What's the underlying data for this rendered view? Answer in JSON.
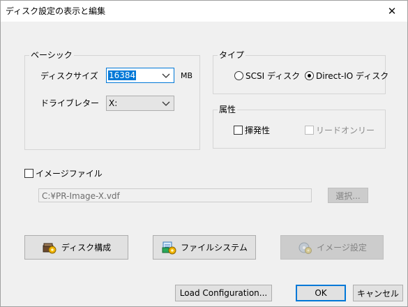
{
  "window": {
    "title": "ディスク設定の表示と編集",
    "close_glyph": "✕"
  },
  "basic": {
    "legend": "ベーシック",
    "disk_size_label": "ディスクサイズ",
    "disk_size_value": "16384",
    "disk_size_unit": "MB",
    "drive_letter_label": "ドライブレター",
    "drive_letter_value": "X:"
  },
  "type": {
    "legend": "タイプ",
    "options": [
      {
        "label": "SCSI ディスク",
        "selected": false
      },
      {
        "label": "Direct-IO ディスク",
        "selected": true
      }
    ]
  },
  "attributes": {
    "legend": "属性",
    "volatile_label": "揮発性",
    "readonly_label": "リードオンリー"
  },
  "image": {
    "checkbox_label": "イメージファイル",
    "path_value": "C:¥PR-Image-X.vdf",
    "browse_label": "選択..."
  },
  "actions": {
    "disk_config_label": "ディスク構成",
    "file_system_label": "ファイルシステム",
    "image_settings_label": "イメージ設定",
    "load_config_label": "Load Configuration...",
    "ok_label": "OK",
    "cancel_label": "キャンセル"
  },
  "icons": {
    "disk_config": "disk-config-icon",
    "file_system": "file-system-icon",
    "image_settings": "image-settings-icon"
  },
  "colors": {
    "accent": "#0078d7",
    "window_bg": "#f0f0f0"
  }
}
